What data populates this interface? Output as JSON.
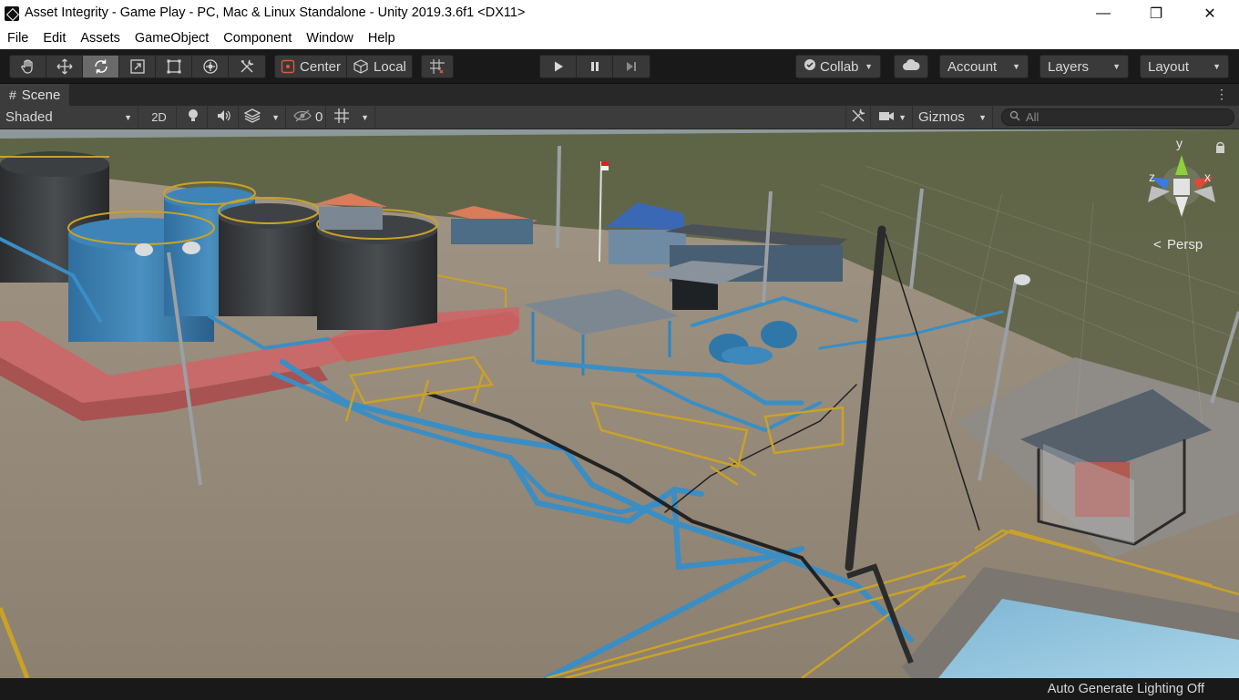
{
  "window": {
    "title": "Asset Integrity - Game Play - PC, Mac & Linux Standalone - Unity 2019.3.6f1 <DX11>",
    "minimize_glyph": "—",
    "maximize_glyph": "❐",
    "close_glyph": "✕"
  },
  "menu": [
    "File",
    "Edit",
    "Assets",
    "GameObject",
    "Component",
    "Window",
    "Help"
  ],
  "toolbar": {
    "tools": [
      "hand-icon",
      "move-icon",
      "rotate-icon",
      "scale-icon",
      "rect-icon",
      "transform-icon",
      "custom-tool-icon"
    ],
    "active_tool": "rotate-icon",
    "pivot_mode": "Center",
    "pivot_rotation": "Local",
    "collab": "Collab",
    "account": "Account",
    "layers": "Layers",
    "layout": "Layout"
  },
  "scene": {
    "tab_label": "Scene",
    "shading_mode": "Shaded",
    "mode_2d": "2D",
    "hidden_count": "0",
    "gizmos": "Gizmos",
    "search_placeholder": "All",
    "projection": "Persp",
    "axis_y": "y",
    "axis_x": "x",
    "axis_z": "z"
  },
  "colors": {
    "toolbar_bg": "#191919",
    "panel_bg": "#3c3c3c",
    "pipe_blue": "#3a8ec4",
    "pipe_red": "#c05a5a",
    "rail_yellow": "#c9a227",
    "gizmo_y": "#8fcf3c",
    "gizmo_x": "#e0483a",
    "gizmo_z": "#3a7be0"
  },
  "status_bar": {
    "message": "Auto Generate Lighting Off"
  }
}
